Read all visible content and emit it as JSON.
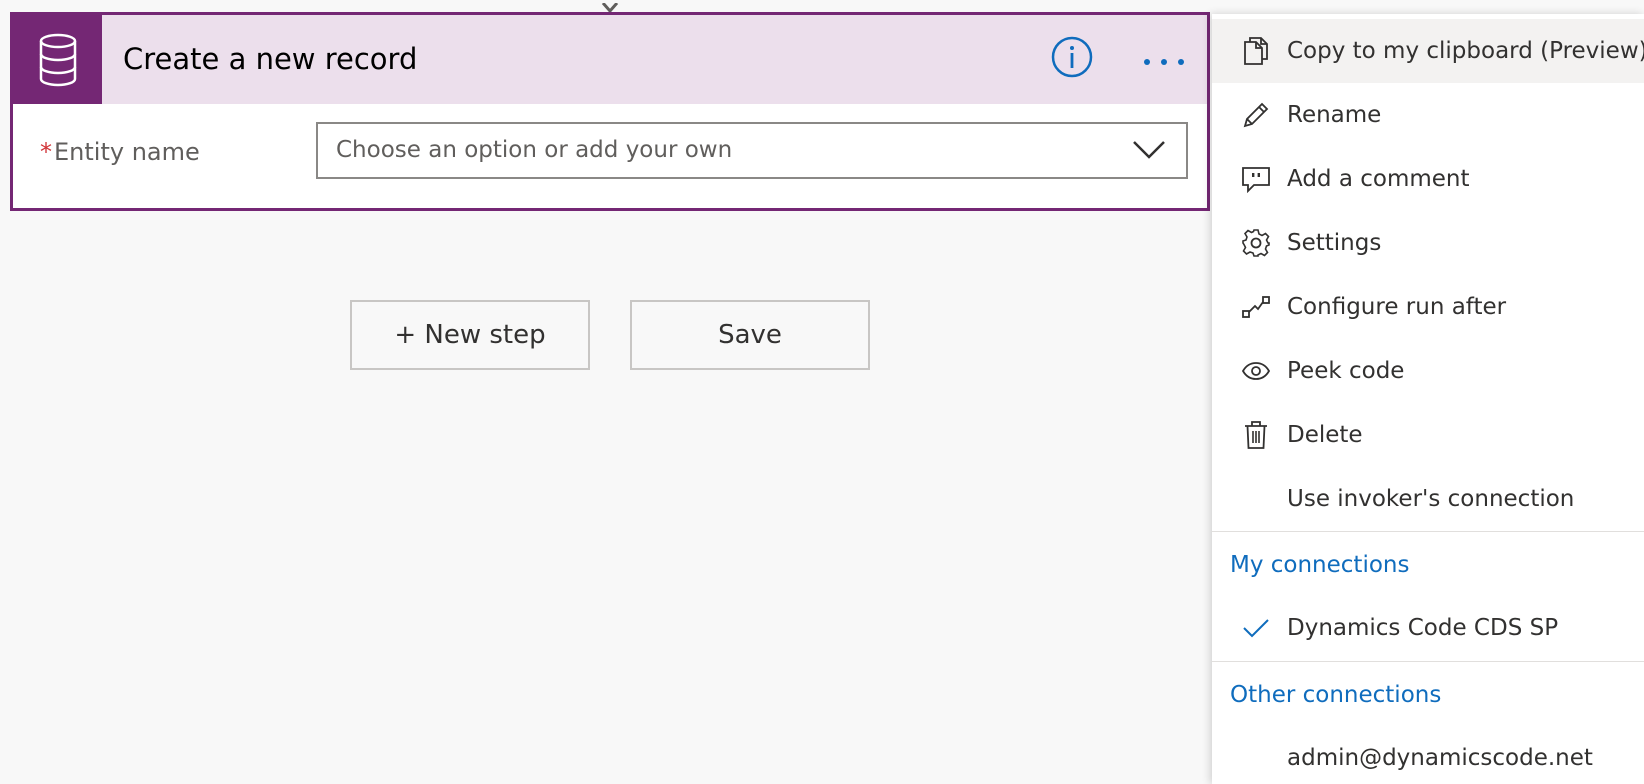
{
  "card": {
    "title": "Create a new record",
    "accent_color": "#742774",
    "header_color": "#ecdfec",
    "icon": "database-icon",
    "info_icon": "info-icon",
    "more_icon": "more-options-icon",
    "field": {
      "required_mark": "*",
      "label": "Entity name",
      "placeholder": "Choose an option or add your own",
      "icon": "chevron-down-icon"
    }
  },
  "buttons": {
    "new_step": "+ New step",
    "save": "Save"
  },
  "menu": {
    "items": [
      {
        "label": "Copy to my clipboard (Preview)",
        "icon": "copy-icon"
      },
      {
        "label": "Rename",
        "icon": "pencil-icon"
      },
      {
        "label": "Add a comment",
        "icon": "comment-icon"
      },
      {
        "label": "Settings",
        "icon": "gear-icon"
      },
      {
        "label": "Configure run after",
        "icon": "run-after-icon"
      },
      {
        "label": "Peek code",
        "icon": "eye-icon"
      },
      {
        "label": "Delete",
        "icon": "trash-icon"
      },
      {
        "label": "Use invoker's connection",
        "icon": ""
      }
    ],
    "my_connections_heading": "My connections",
    "my_connections": [
      {
        "label": "Dynamics Code CDS SP",
        "icon": "checkmark-icon",
        "selected": true
      }
    ],
    "other_connections_heading": "Other connections",
    "other_connections": [
      {
        "label": "admin@dynamicscode.net",
        "icon": ""
      }
    ],
    "section_color": "#0f6cbd"
  }
}
